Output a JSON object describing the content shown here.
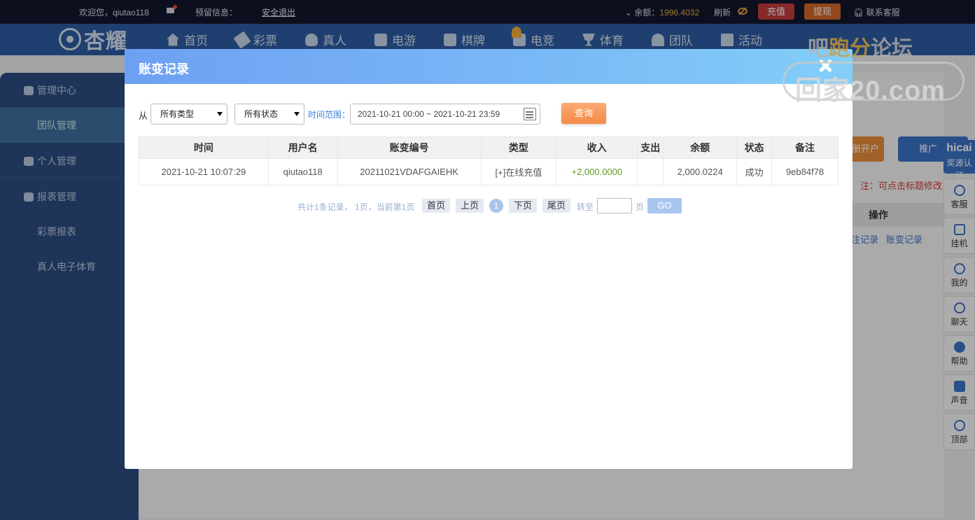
{
  "topbar": {
    "welcome": "欢迎您，qiutao118",
    "reserved": "预留信息：",
    "logout": "安全退出",
    "balance_label": "余额：",
    "balance_value": "1996.4032",
    "refresh": "刷新",
    "recharge": "充值",
    "withdraw": "提现",
    "support": "联系客服"
  },
  "nav": {
    "logo": "杏耀",
    "items": [
      "首页",
      "彩票",
      "真人",
      "电游",
      "棋牌",
      "电竞",
      "体育",
      "团队",
      "活动"
    ]
  },
  "watermark": {
    "top_a": "吧",
    "top_b": "跑分",
    "top_c": "论坛",
    "bottom": "回家20.com"
  },
  "sidebar": {
    "items": [
      "管理中心",
      "团队管理",
      "个人管理",
      "报表管理",
      "彩票报表",
      "真人电子体育"
    ]
  },
  "background": {
    "btn1": "册开户",
    "btn2": "推广",
    "note": "注：可点击标题修改",
    "col_header": "操作",
    "links": [
      "注记录",
      "账变记录"
    ]
  },
  "right_toolbar": {
    "head_a": "hicai",
    "head_b": "奖源认证",
    "items": [
      "客服",
      "挂机",
      "我的",
      "聊天",
      "帮助",
      "声音",
      "顶部"
    ]
  },
  "modal": {
    "title": "账变记录",
    "filter": {
      "from": "从",
      "type_select": "所有类型",
      "status_select": "所有状态",
      "range_label": "时间范围：",
      "range_value": "2021-10-21 00:00 ~ 2021-10-21 23:59",
      "query": "查询"
    },
    "columns": [
      "时间",
      "用户名",
      "账变编号",
      "类型",
      "收入",
      "支出",
      "余额",
      "状态",
      "备注"
    ],
    "rows": [
      [
        "2021-10-21 10:07:29",
        "qiutao118",
        "20211021VDAFGAIEHK",
        "[+]在线充值",
        "+2,000.0000",
        "",
        "2,000.0224",
        "成功",
        "9eb84f78"
      ]
    ],
    "pager": {
      "info": "共计1条记录， 1页，当前第1页",
      "first": "首页",
      "prev": "上页",
      "current": "1",
      "next": "下页",
      "last": "尾页",
      "goto": "转至",
      "page": "页",
      "go": "GO"
    }
  }
}
